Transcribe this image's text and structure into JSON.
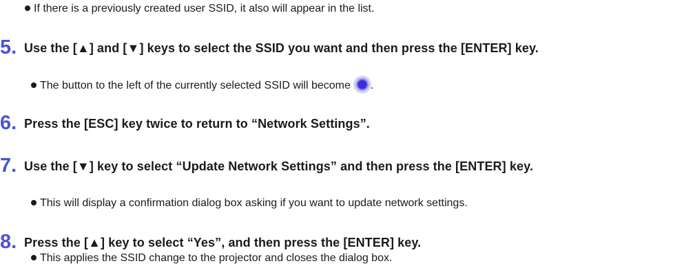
{
  "steps": [
    {
      "number": "5.",
      "text": "Use the [▲] and [▼] keys to select the SSID you want and then press the [ENTER] key.",
      "bullet": "The button to the left of the currently selected SSID will become",
      "bullet_suffix": ".",
      "bullet_icon": "selected-radio-button-icon"
    },
    {
      "number": "6.",
      "text": "Press the [ESC] key twice to return to “Network Settings”."
    },
    {
      "number": "7.",
      "text": "Use the [▼] key to select “Update Network Settings” and then press the [ENTER] key.",
      "bullet": "This will display a confirmation dialog box asking if you want to update network settings."
    },
    {
      "number": "8.",
      "text": "Press the [▲] key to select “Yes”, and then press the [ENTER] key.",
      "bullet": "This applies the SSID change to the projector and closes the dialog box."
    }
  ],
  "intro_bullet": "If there is a previously created user SSID, it also will appear in the list.",
  "colors": {
    "step_number": "#4a54d4",
    "text": "#1a1a1a"
  }
}
